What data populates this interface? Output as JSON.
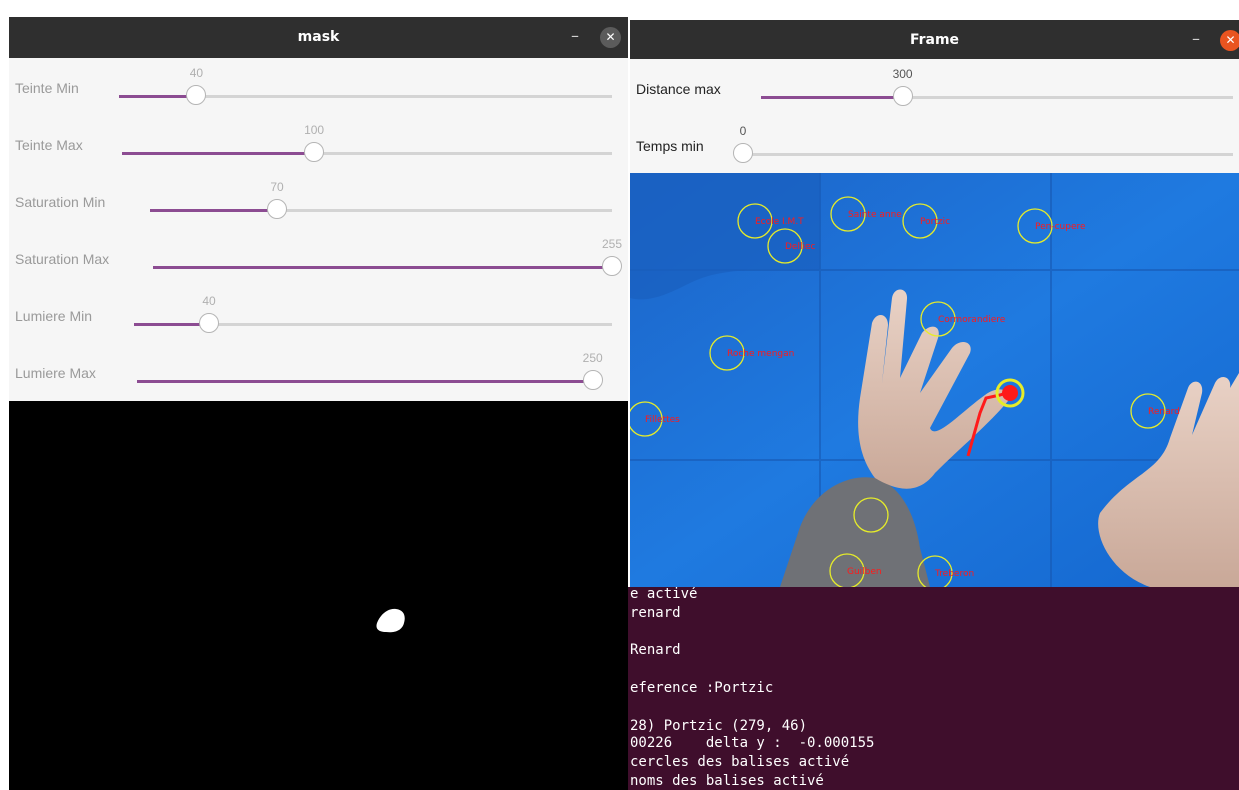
{
  "colors": {
    "titlebar": "#2f2f2f",
    "accent": "#8c4c92",
    "terminal_bg": "#3f0e2c",
    "close_gray": "#5b5b5b",
    "close_orange": "#e95420",
    "board_blue": "#1a73d9",
    "marker_yellow": "#e6ec2a",
    "marker_red": "#ff1a1a"
  },
  "mask_window": {
    "title": "mask",
    "minimize_label": "–",
    "close_label": "✕",
    "sliders": [
      {
        "label": "Teinte Min",
        "value": "40",
        "fraction": 0.157
      },
      {
        "label": "Teinte Max",
        "value": "100",
        "fraction": 0.392
      },
      {
        "label": "Saturation Min",
        "value": "70",
        "fraction": 0.275
      },
      {
        "label": "Saturation Max",
        "value": "255",
        "fraction": 1.0
      },
      {
        "label": "Lumiere Min",
        "value": "40",
        "fraction": 0.157
      },
      {
        "label": "Lumiere Max",
        "value": "250",
        "fraction": 0.98
      }
    ]
  },
  "frame_window": {
    "title": "Frame",
    "minimize_label": "–",
    "close_label": "✕",
    "sliders": [
      {
        "label": "Distance max",
        "value": "300",
        "fraction": 0.3
      },
      {
        "label": "Temps min",
        "value": "0",
        "fraction": 0.0
      }
    ],
    "markers": [
      {
        "label": "Ecole I.M.T"
      },
      {
        "label": "Sainte anne"
      },
      {
        "label": "Portzic"
      },
      {
        "label": "Pen-cupere"
      },
      {
        "label": "Delliec"
      },
      {
        "label": "Cormorandiere"
      },
      {
        "label": "Roche mengan"
      },
      {
        "label": "Renard"
      },
      {
        "label": "Fillettes"
      },
      {
        "label": ""
      },
      {
        "label": "Guilben"
      },
      {
        "label": "Treberon"
      }
    ]
  },
  "terminal": {
    "lines": [
      "e activé",
      "renard",
      "",
      "Renard",
      "",
      "eference :Portzic",
      "",
      "28) Portzic (279, 46)",
      "00226    delta y :  -0.000155",
      "cercles des balises activé",
      "noms des balises activé"
    ]
  }
}
